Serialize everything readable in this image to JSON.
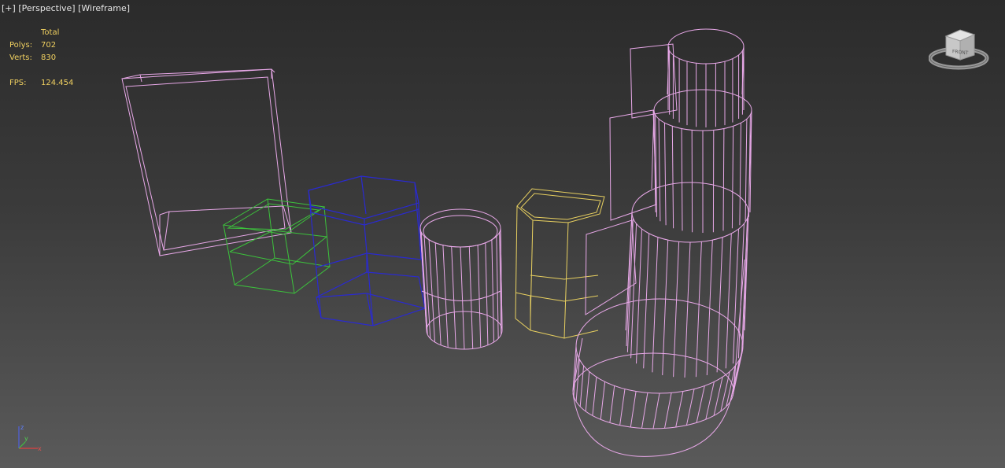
{
  "viewport": {
    "plus_label": "[+]",
    "view_label": "[Perspective]",
    "shading_label": "[Wireframe]"
  },
  "stats": {
    "header": "Total",
    "polys_label": "Polys:",
    "polys_value": "702",
    "verts_label": "Verts:",
    "verts_value": "830",
    "fps_label": "FPS:",
    "fps_value": "124.454"
  },
  "viewcube": {
    "face_label": "FRONT",
    "icon": "viewcube-icon"
  },
  "axis_tripod": {
    "x_label": "x",
    "y_label": "y",
    "z_label": "z"
  },
  "colors": {
    "pink": "#e8a8e8",
    "green": "#3cc23c",
    "blue": "#2a2ad0",
    "yellow": "#e8d060",
    "stats_text": "#f0d060"
  }
}
